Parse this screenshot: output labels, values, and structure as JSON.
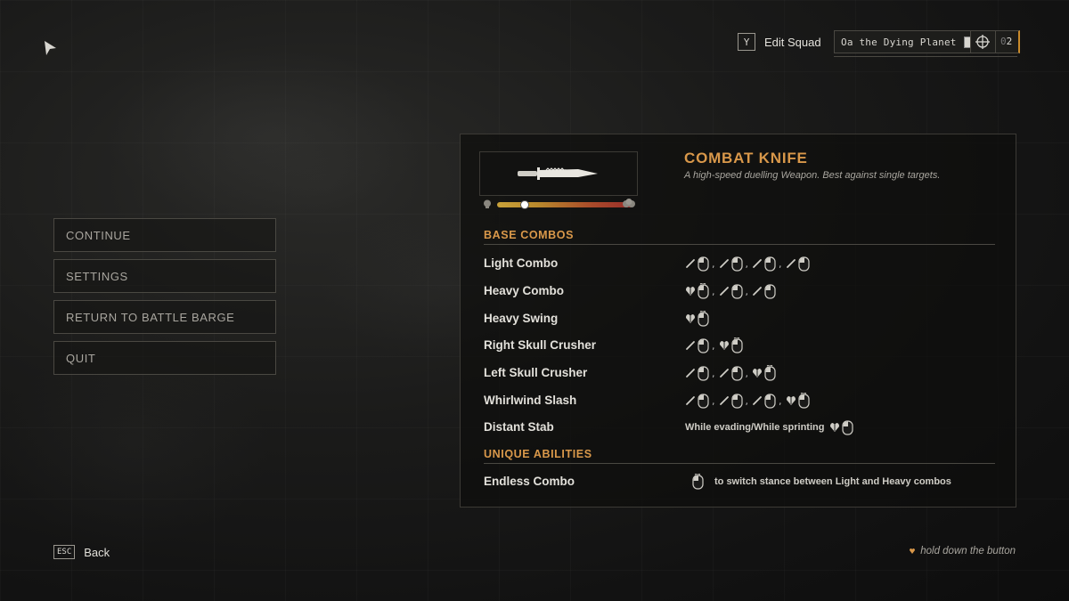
{
  "top_bar": {
    "edit_key": "Y",
    "edit_label": "Edit Squad",
    "planet": "Oa the Dying Planet",
    "count_prefix": "0",
    "count_value": "2"
  },
  "menu": {
    "items": [
      {
        "label": "CONTINUE"
      },
      {
        "label": "SETTINGS"
      },
      {
        "label": "RETURN TO BATTLE BARGE"
      },
      {
        "label": "QUIT"
      }
    ]
  },
  "weapon": {
    "name": "COMBAT KNIFE",
    "description": "A high-speed duelling Weapon. Best against single targets.",
    "meter_level": 0.2
  },
  "sections": {
    "base": "BASE COMBOS",
    "unique": "UNIQUE ABILITIES"
  },
  "combos": [
    {
      "name": "Light Combo"
    },
    {
      "name": "Heavy Combo"
    },
    {
      "name": "Heavy Swing"
    },
    {
      "name": "Right Skull Crusher"
    },
    {
      "name": "Left Skull Crusher"
    },
    {
      "name": "Whirlwind Slash"
    },
    {
      "name": "Distant Stab",
      "prefix": "While evading/While sprinting"
    }
  ],
  "abilities": [
    {
      "name": "Endless Combo",
      "text": "to switch stance between Light and Heavy combos"
    }
  ],
  "bottom": {
    "back_key": "ESC",
    "back_label": "Back",
    "hint": "hold down the button"
  },
  "colors": {
    "accent": "#d9984a",
    "text": "#e2e0da"
  }
}
